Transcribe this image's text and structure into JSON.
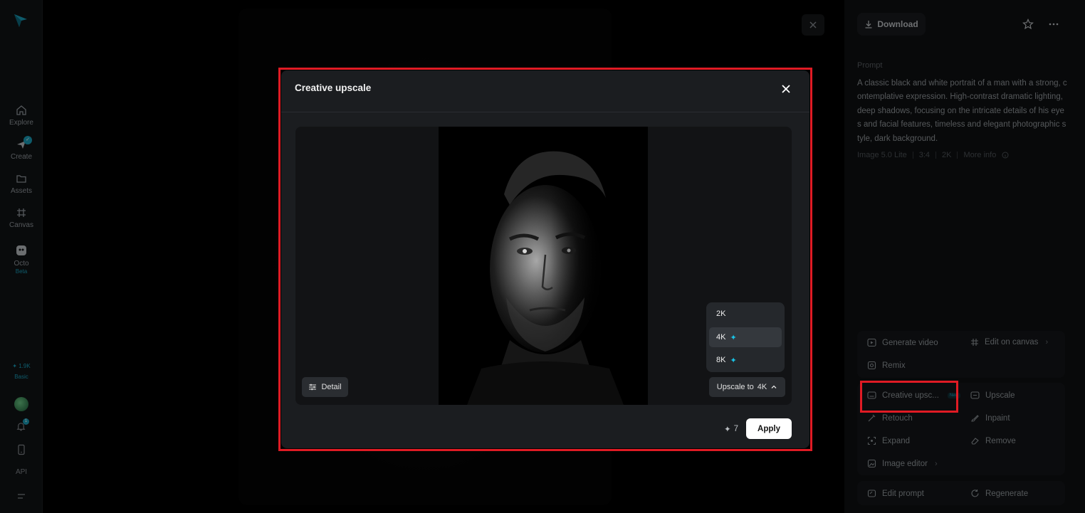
{
  "nav": {
    "items": [
      {
        "label": "Explore"
      },
      {
        "label": "Create"
      },
      {
        "label": "Assets"
      },
      {
        "label": "Canvas"
      },
      {
        "label": "Octo",
        "tag": "Beta"
      }
    ],
    "credits": "1.9K",
    "plan": "Basic",
    "api_label": "API",
    "notification_count": "1"
  },
  "side_panel": {
    "download_label": "Download",
    "prompt_heading": "Prompt",
    "prompt_text": "A classic black and white portrait of a man with a strong, contemplative expression. High-contrast dramatic lighting, deep shadows, focusing on the intricate details of his eyes and facial features, timeless and elegant photographic style, dark background.",
    "meta": {
      "model": "Image 5.0 Lite",
      "ratio": "3:4",
      "resolution": "2K",
      "more_info": "More info"
    },
    "actions_group1": {
      "generate_video": "Generate video",
      "edit_on_canvas": "Edit on canvas",
      "remix": "Remix"
    },
    "actions_group2": {
      "creative_upscale": "Creative upsc...",
      "new_tag": "New",
      "upscale": "Upscale",
      "retouch": "Retouch",
      "inpaint": "Inpaint",
      "expand": "Expand",
      "remove": "Remove",
      "image_editor": "Image editor"
    },
    "actions_group3": {
      "edit_prompt": "Edit prompt",
      "regenerate": "Regenerate"
    }
  },
  "modal": {
    "title": "Creative upscale",
    "detail_label": "Detail",
    "resolution_options": [
      {
        "label": "2K",
        "premium": false
      },
      {
        "label": "4K",
        "premium": true,
        "selected": true
      },
      {
        "label": "8K",
        "premium": true
      }
    ],
    "upscale_prefix": "Upscale to",
    "upscale_value": "4K",
    "cost": "7",
    "apply_label": "Apply"
  },
  "colors": {
    "accent": "#1aa7c4",
    "highlight": "#e01b24",
    "modal_bg": "#1b1d20"
  }
}
